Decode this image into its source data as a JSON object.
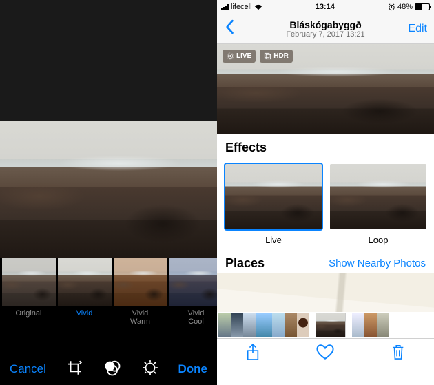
{
  "editor": {
    "cancel_label": "Cancel",
    "done_label": "Done",
    "filters": [
      {
        "label": "Original",
        "variant": "orig",
        "selected": false
      },
      {
        "label": "Vivid",
        "variant": "",
        "selected": true
      },
      {
        "label": "Vivid\nWarm",
        "variant": "warm",
        "selected": false
      },
      {
        "label": "Vivid\nCool",
        "variant": "cool",
        "selected": false
      }
    ],
    "tool_icons": [
      "crop-rotate-icon",
      "filters-icon",
      "adjust-icon"
    ]
  },
  "detail": {
    "status": {
      "carrier": "lifecell",
      "time": "13:14",
      "battery_pct": "48%",
      "battery_fill": 48
    },
    "nav": {
      "location": "Bláskógabyggð",
      "date": "February 7, 2017  13:21",
      "edit_label": "Edit"
    },
    "badges": {
      "live": "LIVE",
      "hdr": "HDR"
    },
    "effects": {
      "heading": "Effects",
      "items": [
        {
          "label": "Live",
          "selected": true
        },
        {
          "label": "Loop",
          "selected": false
        }
      ]
    },
    "places": {
      "heading": "Places",
      "link": "Show Nearby Photos"
    },
    "toolbar_icons": [
      "share-icon",
      "favorite-icon",
      "trash-icon"
    ]
  }
}
